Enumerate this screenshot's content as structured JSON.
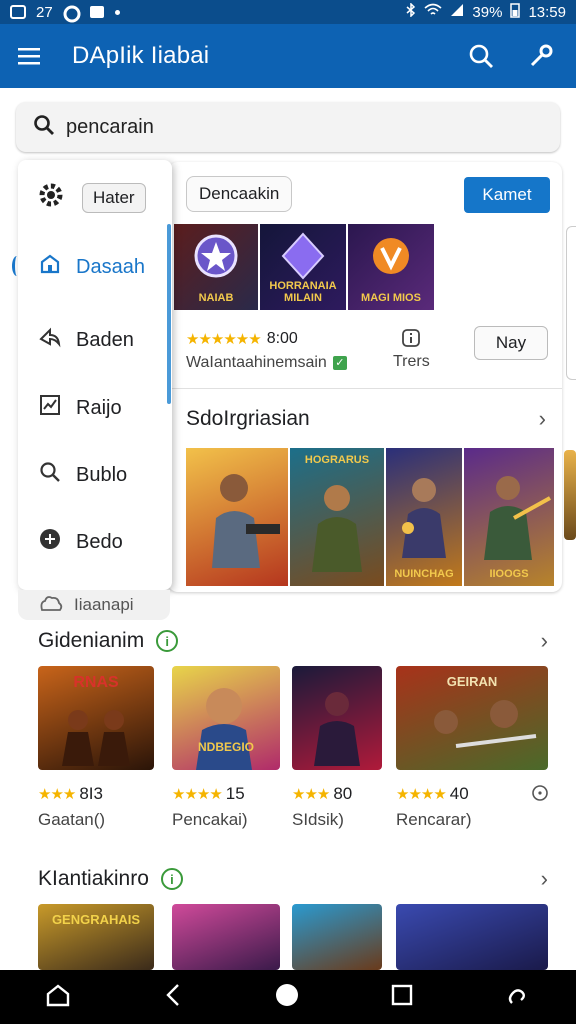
{
  "status_bar": {
    "left_text": "27",
    "battery": "39%",
    "time": "13:59"
  },
  "app_bar": {
    "title": "DApIik Iiabai",
    "icons": [
      "menu-icon",
      "search-icon",
      "wrench-icon"
    ]
  },
  "search": {
    "value": "pencarain"
  },
  "drawer": {
    "filter_label": "Hater",
    "items": [
      {
        "label": "Dasaah",
        "icon": "home-icon",
        "active": true
      },
      {
        "label": "Baden",
        "icon": "share-icon",
        "active": false
      },
      {
        "label": "Raijo",
        "icon": "chart-icon",
        "active": false
      },
      {
        "label": "Bublo",
        "icon": "search-icon",
        "active": false
      },
      {
        "label": "Bedo",
        "icon": "compass-icon",
        "active": false
      }
    ],
    "below_label": "Iiaanapi"
  },
  "featured": {
    "chip_label": "Dencaakin",
    "primary_button": "Kamet",
    "thumbnails": [
      {
        "caption": "NAIAB",
        "colors": [
          "#5b1d1d",
          "#2a2a4a"
        ],
        "accent": "#6a56c9"
      },
      {
        "caption": "HORRANAIA MILAIN",
        "colors": [
          "#14163a",
          "#2e1a5e"
        ],
        "accent": "#8a6cf0"
      },
      {
        "caption": "MAGI MIOS",
        "colors": [
          "#2b174f",
          "#5a2a7a"
        ],
        "accent": "#f08a24"
      }
    ],
    "rating": "8:00",
    "stars": "★★★★★★",
    "subtitle": "WaIantaahinemsain",
    "info_label": "Trers",
    "outline_button": "Nay"
  },
  "section_one": {
    "title": "SdoIrgriasian",
    "thumbnails": [
      {
        "caption": "",
        "colors": [
          "#f2c14a",
          "#b5361e"
        ]
      },
      {
        "caption": "HOGRARUS",
        "colors": [
          "#1c6f8a",
          "#7a4b1e"
        ]
      },
      {
        "caption": "NUINCHAG",
        "colors": [
          "#2a2f7a",
          "#c27a1a"
        ]
      },
      {
        "caption": "IIOOGS",
        "colors": [
          "#5a2a8a",
          "#b8842a"
        ]
      }
    ]
  },
  "section_two": {
    "title": "Gidenianim",
    "items": [
      {
        "caption": "RNAS",
        "rating": "8I3",
        "stars": "★★★",
        "label": "Gaatan()",
        "colors": [
          "#c8641a",
          "#2a1408"
        ]
      },
      {
        "caption": "NDBEGIO",
        "rating": "15",
        "stars": "★★★★",
        "label": "Pencakai)",
        "colors": [
          "#e8d54a",
          "#b02a6a"
        ]
      },
      {
        "caption": "",
        "rating": "80",
        "stars": "★★★",
        "label": "SIdsik)",
        "colors": [
          "#1a1a3a",
          "#b01a3a"
        ]
      },
      {
        "caption": "GEIRAN",
        "rating": "40",
        "stars": "★★★★",
        "label": "Rencarar)",
        "colors": [
          "#a8321a",
          "#4a6a2a"
        ]
      }
    ]
  },
  "section_three": {
    "title": "KIantiakinro",
    "thumbnails": [
      {
        "caption": "GENGRAHAIS",
        "colors": [
          "#c89a2a",
          "#3a2a1a"
        ]
      },
      {
        "caption": "",
        "colors": [
          "#d04a9a",
          "#3a1a4a"
        ]
      },
      {
        "caption": "",
        "colors": [
          "#2a9ad0",
          "#6a3a1a"
        ]
      },
      {
        "caption": "",
        "colors": [
          "#3a4ab0",
          "#1a1a4a"
        ]
      }
    ]
  },
  "nav_bar": {
    "icons": [
      "home-icon",
      "back-icon",
      "home-circle-icon",
      "recents-icon",
      "assistant-icon"
    ]
  }
}
